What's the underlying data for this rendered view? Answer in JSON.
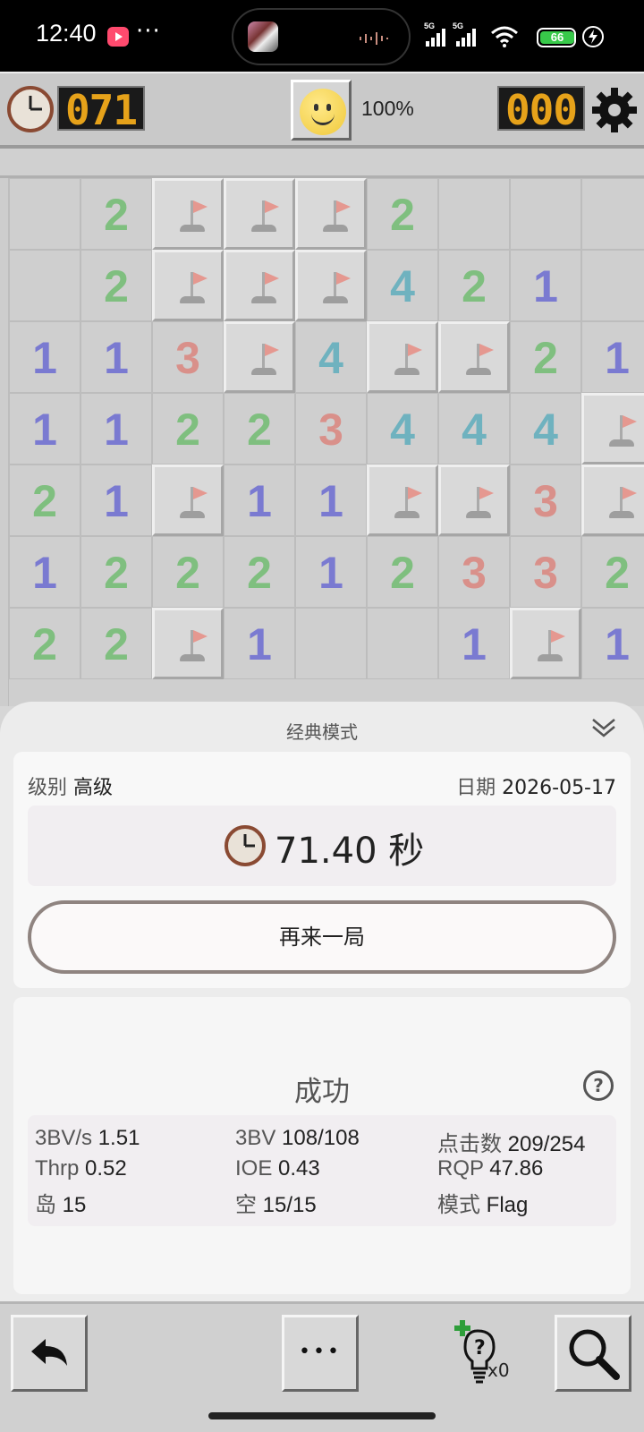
{
  "status_bar": {
    "time": "12:40",
    "more": "···",
    "network_1": "5G",
    "network_2": "5G",
    "battery": "66"
  },
  "hud": {
    "timer": "071",
    "zoom": "100%",
    "mines_left": "000"
  },
  "board": {
    "colors": {
      "1": "#7a7ad1",
      "2": "#7fbf7f",
      "3": "#d9908a",
      "4": "#6fb2bf"
    },
    "rows": [
      [
        "",
        "2",
        "F",
        "F",
        "F",
        "2",
        "",
        "",
        ""
      ],
      [
        "",
        "2",
        "F",
        "F",
        "F",
        "4",
        "2",
        "1",
        ""
      ],
      [
        "1",
        "1",
        "3",
        "F",
        "4",
        "F",
        "F",
        "2",
        "1"
      ],
      [
        "1",
        "1",
        "2",
        "2",
        "3",
        "4",
        "4",
        "4",
        "F"
      ],
      [
        "2",
        "1",
        "F",
        "1",
        "1",
        "F",
        "F",
        "3",
        "F"
      ],
      [
        "1",
        "2",
        "2",
        "2",
        "1",
        "2",
        "3",
        "3",
        "2"
      ],
      [
        "2",
        "2",
        "F",
        "1",
        "",
        "",
        "1",
        "F",
        "1"
      ]
    ]
  },
  "sheet": {
    "title": "经典模式",
    "level_label": "级别",
    "level_value": "高级",
    "date_label": "日期",
    "date_value": "2026-05-17",
    "time_value": "71.40 秒",
    "again_button": "再来一局",
    "result": "成功",
    "help": "?",
    "stats": [
      {
        "k": "3BV/s",
        "v": "1.51"
      },
      {
        "k": "3BV",
        "v": "108/108"
      },
      {
        "k": "点击数",
        "v": "209/254"
      },
      {
        "k": "Thrp",
        "v": "0.52"
      },
      {
        "k": "IOE",
        "v": "0.43"
      },
      {
        "k": "RQP",
        "v": "47.86"
      },
      {
        "k": "岛",
        "v": "15"
      },
      {
        "k": "空",
        "v": "15/15"
      },
      {
        "k": "模式",
        "v": "Flag"
      }
    ]
  },
  "toolbar": {
    "hint_count": "x0",
    "more_button": "•••"
  },
  "icons": [
    "clock-icon",
    "smiley-face-icon",
    "gear-icon",
    "flag-icon",
    "chevron-down-icon",
    "help-icon",
    "undo-icon",
    "more-icon",
    "hint-bulb-icon",
    "magnifier-icon"
  ]
}
